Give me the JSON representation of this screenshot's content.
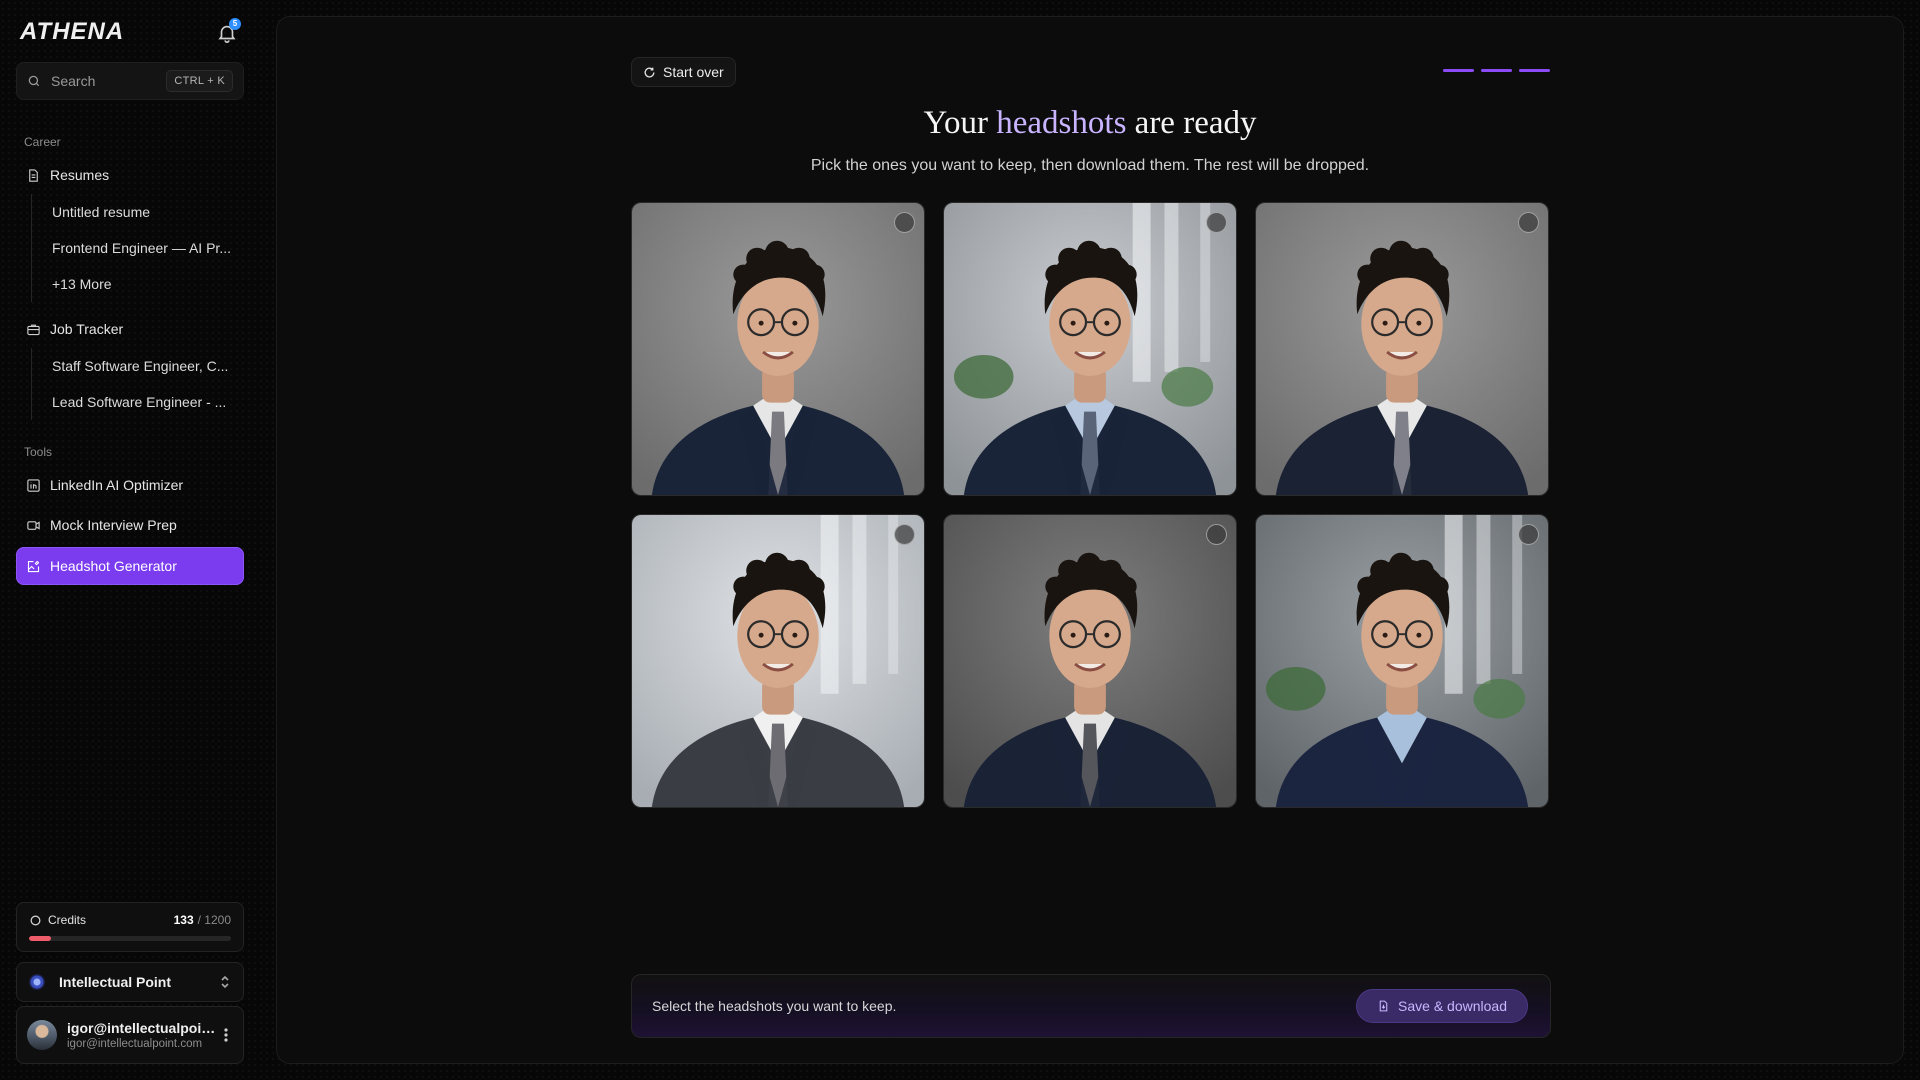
{
  "app": {
    "logo_text": "ATHENA",
    "notification_count": "5"
  },
  "search": {
    "label": "Search",
    "shortcut": "CTRL + K"
  },
  "sidebar": {
    "career_label": "Career",
    "resumes_label": "Resumes",
    "resumes": [
      "Untitled resume",
      "Frontend Engineer — AI Pr...",
      "+13 More"
    ],
    "job_tracker_label": "Job Tracker",
    "jobs": [
      "Staff Software Engineer, C...",
      "Lead Software Engineer - ..."
    ],
    "tools_label": "Tools",
    "tools": [
      {
        "label": "LinkedIn AI Optimizer",
        "icon": "linkedin-icon"
      },
      {
        "label": "Mock Interview Prep",
        "icon": "video-icon"
      },
      {
        "label": "Headshot Generator",
        "icon": "image-edit-icon",
        "active": true
      }
    ]
  },
  "credits": {
    "label": "Credits",
    "used": "133",
    "total": "/ 1200",
    "fraction": 0.11
  },
  "org": {
    "name": "Intellectual Point"
  },
  "user": {
    "name": "igor@intellectualpoin...",
    "email": "igor@intellectualpoint.com"
  },
  "main": {
    "start_over": "Start over",
    "steps": 3,
    "title_pre": "Your ",
    "title_accent": "headshots",
    "title_post": " are ready",
    "subtitle": "Pick the ones you want to keep, then download them. The rest will be dropped.",
    "headshots": [
      {
        "bg": "studio-gray",
        "suit": "#1a2438",
        "shirt": "#e6e6e6",
        "tie": "#7a7a80"
      },
      {
        "bg": "office-window",
        "suit": "#1a2438",
        "shirt": "#b8c8de",
        "tie": "#5a6478"
      },
      {
        "bg": "studio-gray",
        "suit": "#1b2233",
        "shirt": "#e8e8e8",
        "tie": "#80808a"
      },
      {
        "bg": "office-bright",
        "suit": "#3a3d44",
        "shirt": "#f0f0f0",
        "tie": "#6c6c72"
      },
      {
        "bg": "studio-dark",
        "suit": "#1a2236",
        "shirt": "#e4e4e4",
        "tie": "#55555c"
      },
      {
        "bg": "office-plants",
        "suit": "#1c2540",
        "shirt": "#a9c0dc",
        "tie": ""
      }
    ],
    "footer_text": "Select the headshots you want to keep.",
    "save_label": "Save & download"
  },
  "colors": {
    "accent": "#7b3cf0",
    "credits_bar": "#ef5d6b"
  }
}
